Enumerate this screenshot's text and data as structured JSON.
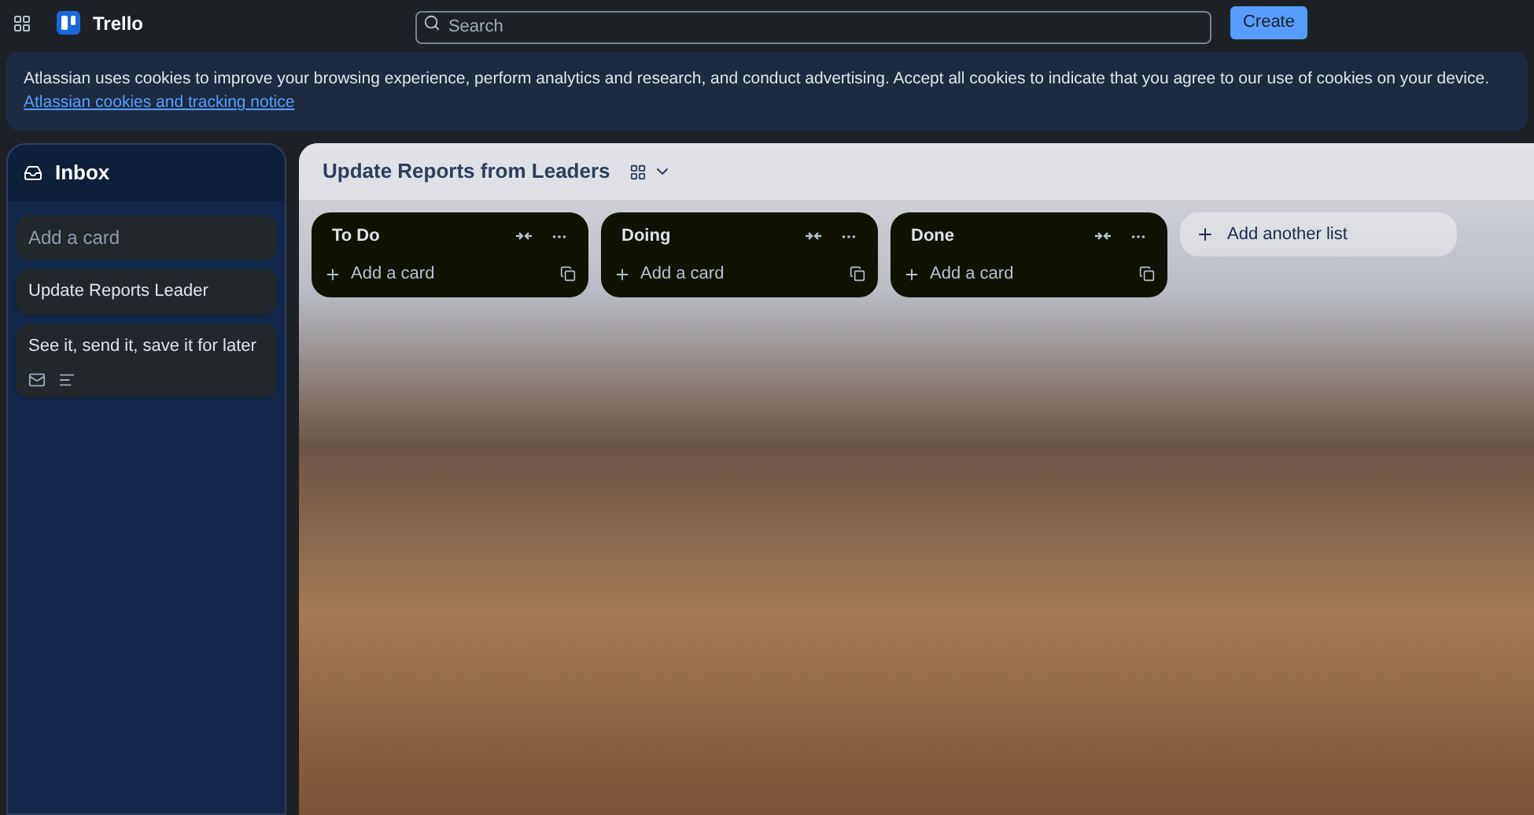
{
  "header": {
    "logo": "Trello",
    "search": {
      "placeholder": "Search"
    },
    "create_button": "Create"
  },
  "cookie_banner": {
    "text": "Atlassian uses cookies to improve your browsing experience, perform analytics and research, and conduct advertising. Accept all cookies to indicate that you agree to our use of cookies on your device.",
    "link": "Atlassian cookies and tracking notice"
  },
  "inbox": {
    "title": "Inbox",
    "add_placeholder": "Add a card",
    "cards": [
      {
        "title": "Update Reports Leader",
        "kind": "plain"
      },
      {
        "title": "See it, send it, save it for later",
        "kind": "badges"
      }
    ]
  },
  "board": {
    "title": "Update Reports from Leaders",
    "lists": [
      {
        "title": "To Do",
        "add_card": "Add a card"
      },
      {
        "title": "Doing",
        "add_card": "Add a card"
      },
      {
        "title": "Done",
        "add_card": "Add a card"
      }
    ],
    "add_list": "Add another list"
  }
}
